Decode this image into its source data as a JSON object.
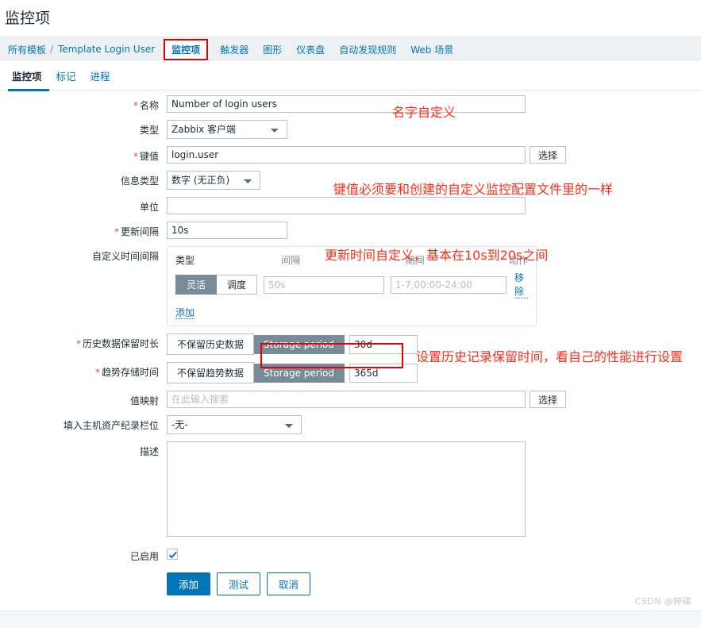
{
  "header": {
    "title": "监控项"
  },
  "nav": {
    "breadcrumb_root": "所有模板",
    "separator": "/",
    "breadcrumb_template": "Template Login User",
    "items": [
      {
        "label": "监控项",
        "active": true,
        "highlighted": true
      },
      {
        "label": "触发器",
        "active": false
      },
      {
        "label": "图形",
        "active": false
      },
      {
        "label": "仪表盘",
        "active": false
      },
      {
        "label": "自动发现规则",
        "active": false
      },
      {
        "label": "Web 场景",
        "active": false
      }
    ]
  },
  "subtabs": [
    {
      "label": "监控项",
      "active": true
    },
    {
      "label": "标记",
      "active": false
    },
    {
      "label": "进程",
      "active": false
    }
  ],
  "form": {
    "name": {
      "label": "名称",
      "required": true,
      "value": "Number of login users"
    },
    "type": {
      "label": "类型",
      "required": false,
      "value": "Zabbix 客户端"
    },
    "key": {
      "label": "键值",
      "required": true,
      "value": "login.user",
      "select_button": "选择"
    },
    "info_type": {
      "label": "信息类型",
      "required": false,
      "value": "数字 (无正负)"
    },
    "units": {
      "label": "单位",
      "required": false,
      "value": ""
    },
    "delay": {
      "label": "更新间隔",
      "required": true,
      "value": "10s"
    },
    "custom_intervals": {
      "label": "自定义时间间隔",
      "columns": {
        "type": "类型",
        "interval": "间隔",
        "period": "期间",
        "action": "动作"
      },
      "rows": [
        {
          "toggle_flexible": "灵活",
          "toggle_scheduling": "调度",
          "selected": "灵活",
          "interval_placeholder": "50s",
          "interval_value": "",
          "period_placeholder": "1-7,00:00-24:00",
          "period_value": "",
          "remove_label": "移除"
        }
      ],
      "add_label": "添加"
    },
    "history": {
      "label": "历史数据保留时长",
      "required": true,
      "toggle_off": "不保留历史数据",
      "toggle_on": "Storage period",
      "selected": "Storage period",
      "value": "30d"
    },
    "trends": {
      "label": "趋势存储时间",
      "required": true,
      "toggle_off": "不保留趋势数据",
      "toggle_on": "Storage period",
      "selected": "Storage period",
      "value": "365d"
    },
    "value_map": {
      "label": "值映射",
      "required": false,
      "value": "",
      "placeholder": "在此输入搜索",
      "select_button": "选择"
    },
    "inventory_field": {
      "label": "填入主机资产纪录栏位",
      "required": false,
      "value": "-无-"
    },
    "description": {
      "label": "描述",
      "required": false,
      "value": "",
      "placeholder": ""
    },
    "enabled": {
      "label": "已启用",
      "checked": true
    }
  },
  "buttons": {
    "add": "添加",
    "test": "测试",
    "cancel": "取消"
  },
  "annotations": [
    {
      "id": "name",
      "text": "名字自定义"
    },
    {
      "id": "key",
      "text": "键值必须要和创建的自定义监控配置文件里的一样"
    },
    {
      "id": "delay",
      "text": "更新时间自定义，基本在10s到20s之间"
    },
    {
      "id": "history",
      "text": "设置历史记录保留时间，看自己的性能进行设置"
    }
  ],
  "watermark": "CSDN @粹碟",
  "colors": {
    "accent_blue": "#0275b8",
    "toggle_gray": "#768d99",
    "annotation_red": "#ff2d18",
    "highlight_red": "#e60000",
    "navbar_bg": "#eef1f4"
  }
}
